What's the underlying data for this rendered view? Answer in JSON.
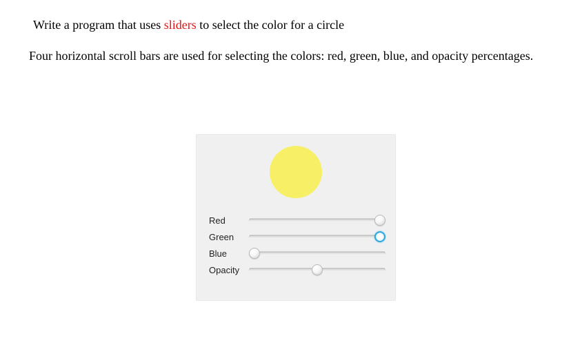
{
  "text": {
    "line1_pre": "Write a program that uses ",
    "line1_red": "sliders",
    "line1_post": " to select the color for a circle",
    "line2": "Four horizontal scroll bars are used for selecting the colors: red, green, blue, and opacity percentages."
  },
  "panel": {
    "circle_color": "#f7ef56",
    "sliders": {
      "red": {
        "label": "Red",
        "value": 100,
        "active": false
      },
      "green": {
        "label": "Green",
        "value": 100,
        "active": true
      },
      "blue": {
        "label": "Blue",
        "value": 0,
        "active": false
      },
      "opacity": {
        "label": "Opacity",
        "value": 50,
        "active": false
      }
    }
  }
}
